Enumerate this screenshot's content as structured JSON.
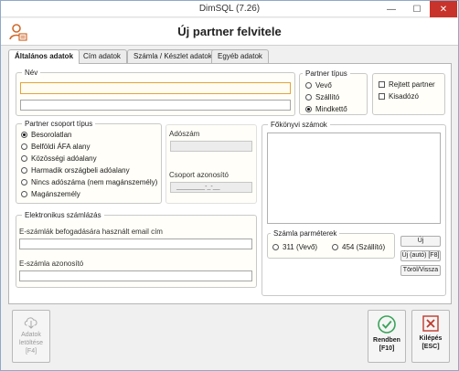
{
  "window": {
    "title": "DimSQL (7.26)",
    "controls": {
      "minimize": "—",
      "maximize": "☐",
      "close": "✕"
    }
  },
  "header": {
    "title": "Új partner felvitele"
  },
  "tabs": [
    {
      "label": "Általános adatok",
      "active": true
    },
    {
      "label": "Cím adatok",
      "active": false
    },
    {
      "label": "Számla / Készlet adatok",
      "active": false
    },
    {
      "label": "Egyéb adatok",
      "active": false
    }
  ],
  "nev": {
    "label": "Név",
    "line1": "",
    "line2": ""
  },
  "partner_tipus": {
    "label": "Partner típus",
    "options": [
      {
        "label": "Vevő",
        "selected": false
      },
      {
        "label": "Szállító",
        "selected": false
      },
      {
        "label": "Mindkettő",
        "selected": true
      }
    ]
  },
  "flags": [
    {
      "label": "Rejtett partner",
      "checked": false
    },
    {
      "label": "Kisadózó",
      "checked": false
    }
  ],
  "csoport_tipus": {
    "label": "Partner csoport típus",
    "options": [
      {
        "label": "Besorolatlan",
        "selected": true
      },
      {
        "label": "Belföldi ÁFA alany",
        "selected": false
      },
      {
        "label": "Közösségi adóalany",
        "selected": false
      },
      {
        "label": "Harmadik országbeli adóalany",
        "selected": false
      },
      {
        "label": "Nincs adószáma (nem magánszemély)",
        "selected": false
      },
      {
        "label": "Magánszemély",
        "selected": false
      }
    ]
  },
  "adoszam": {
    "label": "Adószám",
    "value": ""
  },
  "csoport_azonosito": {
    "label": "Csoport azonosító",
    "value": "________-_-__"
  },
  "fokonyvi": {
    "label": "Főkönyvi számok"
  },
  "szamla_parameterek": {
    "label": "Számla parméterek",
    "options": [
      {
        "label": "311 (Vevő)",
        "selected": false
      },
      {
        "label": "454 (Szállító)",
        "selected": false
      }
    ]
  },
  "side_buttons": {
    "uj": "Új",
    "uj_auto": "Új (autó) [F8]",
    "torol": "Töröl/Vissza"
  },
  "einvoice": {
    "label": "Elektronikus számlázás",
    "email_label": "E-számlák befogadására használt email cím",
    "email_value": "",
    "id_label": "E-számla azonosító",
    "id_value": ""
  },
  "bottom": {
    "adatok_letoltese": "Adatok letöltése [F4]",
    "rendben": "Rendben [F10]",
    "kilepes": "Kilépés [ESC]"
  },
  "colors": {
    "accent_focus": "#e2a33a",
    "close_red": "#c8332b",
    "ok_green": "#3aa35a",
    "exit_red": "#c0392b"
  }
}
